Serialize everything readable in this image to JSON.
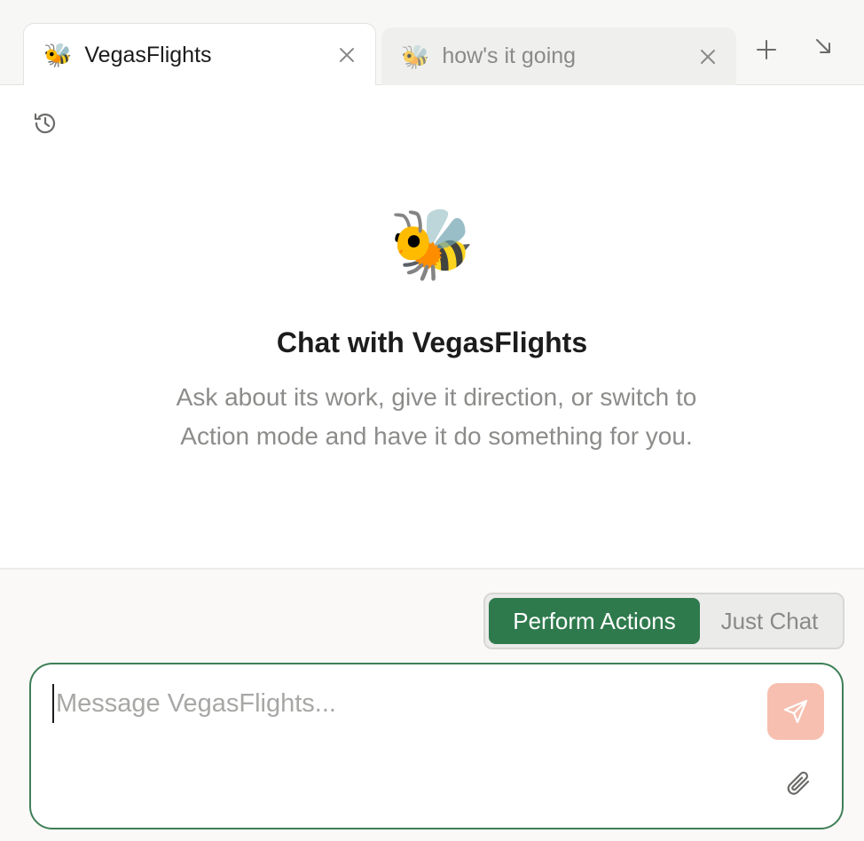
{
  "tabs": [
    {
      "emoji": "🐝",
      "title": "VegasFlights",
      "active": true
    },
    {
      "emoji": "🐝",
      "title": "how's it going",
      "active": false
    }
  ],
  "toolbar": {
    "new_tab_icon": "plus-icon",
    "minimize_icon": "arrow-down-right-icon"
  },
  "main": {
    "history_icon": "history-icon",
    "hero_emoji": "🐝",
    "title": "Chat with VegasFlights",
    "description": "Ask about its work, give it direction, or switch to Action mode and have it do something for you."
  },
  "composer": {
    "modes": [
      {
        "label": "Perform Actions",
        "active": true
      },
      {
        "label": "Just Chat",
        "active": false
      }
    ],
    "placeholder": "Message VegasFlights...",
    "value": "",
    "send_icon": "send-icon",
    "attach_icon": "paperclip-icon"
  },
  "colors": {
    "accent_green": "#2f7a4d",
    "send_button": "#f6bfb0",
    "input_border": "#3f7f57"
  }
}
